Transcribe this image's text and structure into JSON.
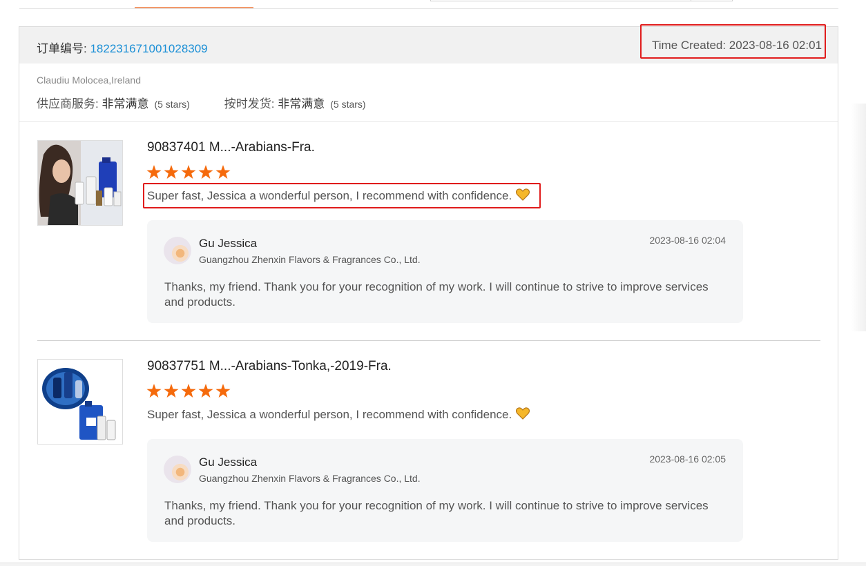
{
  "order": {
    "label": "订单编号: ",
    "number": "182231671001028309",
    "time_created": "Time Created: 2023-08-16 02:01"
  },
  "buyer": {
    "name": "Claudiu Molocea,Ireland",
    "supplier_service_label": "供应商服务: ",
    "supplier_service_value": "非常满意",
    "supplier_service_stars": "(5 stars)",
    "on_time_label": "按时发货: ",
    "on_time_value": "非常满意",
    "on_time_stars": "(5 stars)"
  },
  "reviews": [
    {
      "title": "90837401 M...-Arabians-Fra.",
      "rating": 5,
      "text": "Super fast, Jessica a wonderful person, I recommend with confidence.",
      "emoji": "heart-icon",
      "reply": {
        "name": "Gu Jessica",
        "company": "Guangzhou Zhenxin Flavors & Fragrances Co., Ltd.",
        "date": "2023-08-16 02:04",
        "text": "Thanks, my friend. Thank you for your recognition of my work. I will continue to strive to improve services and products."
      }
    },
    {
      "title": "90837751 M...-Arabians-Tonka,-2019-Fra.",
      "rating": 5,
      "text": "Super fast, Jessica a wonderful person, I recommend with confidence.",
      "emoji": "heart-icon",
      "reply": {
        "name": "Gu Jessica",
        "company": "Guangzhou Zhenxin Flavors & Fragrances Co., Ltd.",
        "date": "2023-08-16 02:05",
        "text": "Thanks, my friend. Thank you for your recognition of my work. I will continue to strive to improve services and products."
      }
    }
  ],
  "colors": {
    "link": "#1a8fd6",
    "star": "#f56a0c",
    "highlight": "#e01b1b",
    "header_bg": "#f1f1f1",
    "reply_bg": "#f5f6f7"
  }
}
